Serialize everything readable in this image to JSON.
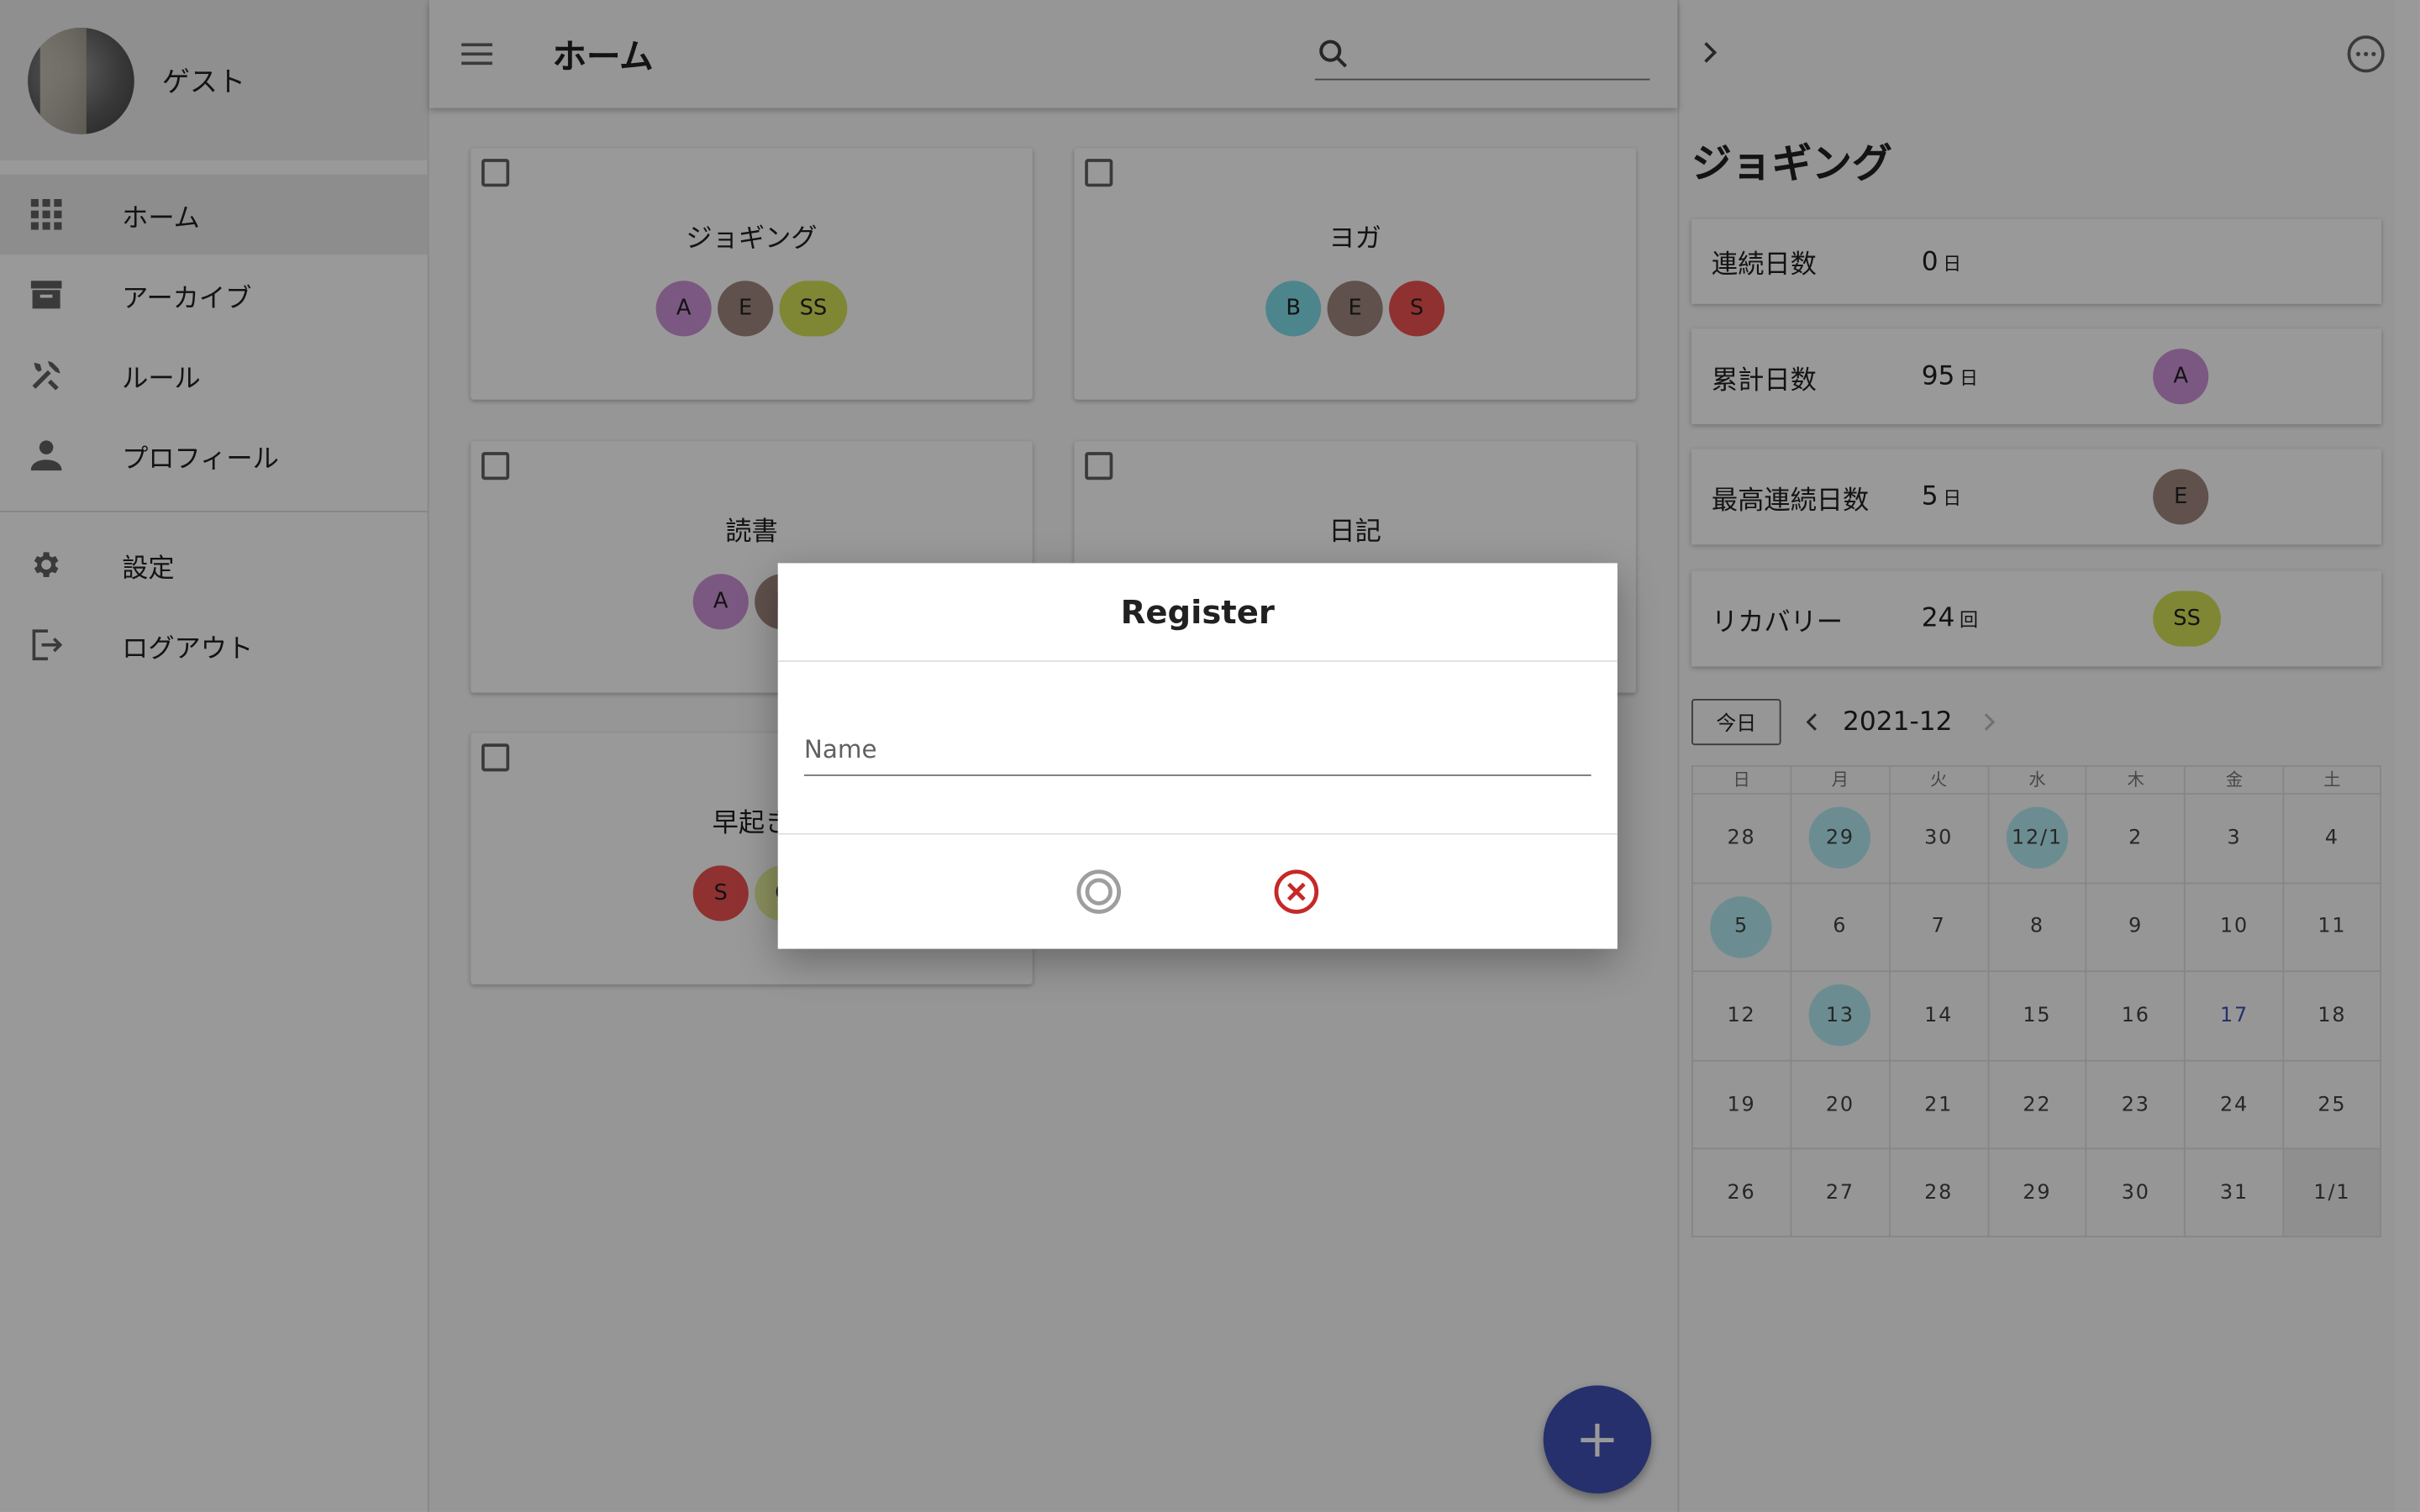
{
  "sidebar": {
    "username": "ゲスト",
    "items": [
      {
        "label": "ホーム",
        "icon": "grid-icon"
      },
      {
        "label": "アーカイブ",
        "icon": "archive-icon"
      },
      {
        "label": "ルール",
        "icon": "tools-icon"
      },
      {
        "label": "プロフィール",
        "icon": "person-icon"
      },
      {
        "label": "設定",
        "icon": "gear-icon"
      },
      {
        "label": "ログアウト",
        "icon": "logout-icon"
      }
    ]
  },
  "header": {
    "title": "ホーム",
    "search_placeholder": ""
  },
  "cards": [
    {
      "title": "ジョギング",
      "members": [
        "A",
        "E",
        "SS"
      ]
    },
    {
      "title": "ヨガ",
      "members": [
        "B",
        "E",
        "S"
      ]
    },
    {
      "title": "読書",
      "members": [
        "A",
        "E"
      ]
    },
    {
      "title": "日記",
      "members": []
    },
    {
      "title": "早起き",
      "members": [
        "S",
        "C"
      ]
    }
  ],
  "colors": {
    "accent": "#3f51b5",
    "chip_a": "#ce93d8",
    "chip_e": "#a1887f",
    "chip_ss": "#d4e157",
    "chip_b": "#80deea",
    "chip_s": "#ef5350",
    "chip_c": "#e6ee9c",
    "cancel": "#c62828"
  },
  "detail": {
    "title": "ジョギング",
    "stats": [
      {
        "label": "連続日数",
        "value": "0",
        "unit": "日",
        "member": ""
      },
      {
        "label": "累計日数",
        "value": "95",
        "unit": "日",
        "member": "A"
      },
      {
        "label": "最高連続日数",
        "value": "5",
        "unit": "日",
        "member": "E"
      },
      {
        "label": "リカバリー",
        "value": "24",
        "unit": "回",
        "member": "SS"
      }
    ],
    "calendar": {
      "today_label": "今日",
      "month": "2021-12",
      "weekdays": [
        "日",
        "月",
        "火",
        "水",
        "木",
        "金",
        "土"
      ],
      "weeks": [
        [
          "28",
          "29",
          "30",
          "12/1",
          "2",
          "3",
          "4"
        ],
        [
          "5",
          "6",
          "7",
          "8",
          "9",
          "10",
          "11"
        ],
        [
          "12",
          "13",
          "14",
          "15",
          "16",
          "17",
          "18"
        ],
        [
          "19",
          "20",
          "21",
          "22",
          "23",
          "24",
          "25"
        ],
        [
          "26",
          "27",
          "28",
          "29",
          "30",
          "31",
          "1/1"
        ]
      ]
    }
  },
  "dialog": {
    "title": "Register",
    "name_placeholder": "Name",
    "name_value": ""
  },
  "fab": {
    "label": "+"
  }
}
